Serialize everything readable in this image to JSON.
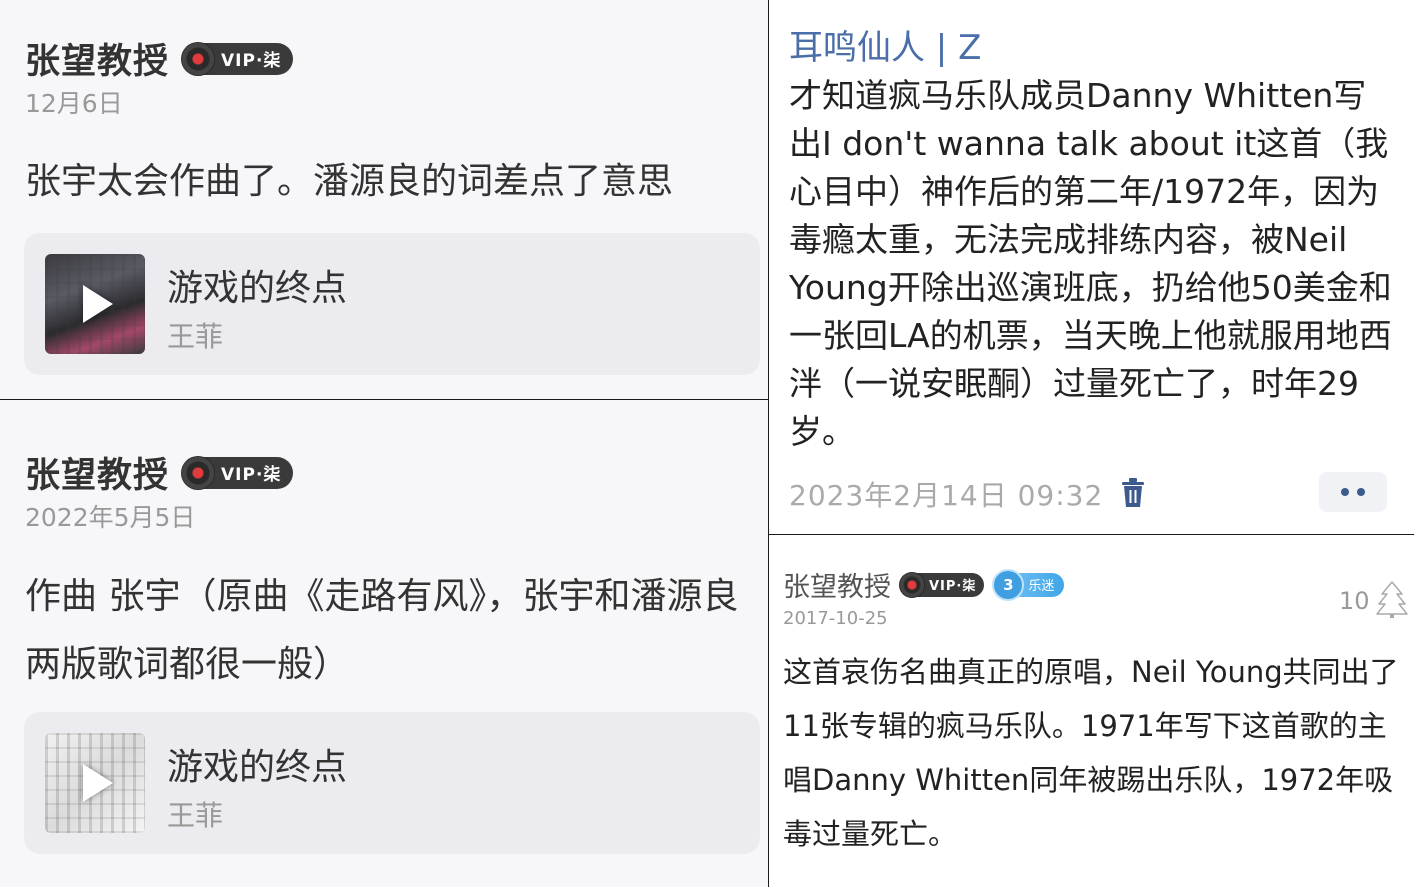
{
  "posts": [
    {
      "author": "张望教授",
      "vip_label": "VIP·柒",
      "date": "12月6日",
      "text": "张宇太会作曲了。潘源良的词差点了意思",
      "song": {
        "title": "游戏的终点",
        "artist": "王菲"
      }
    },
    {
      "author": "张望教授",
      "vip_label": "VIP·柒",
      "date": "2022年5月5日",
      "text": "作曲 张宇（原曲《走路有风》，张宇和潘源良两版歌词都很一般）",
      "song": {
        "title": "游戏的终点",
        "artist": "王菲"
      }
    }
  ],
  "right_top": {
    "author": "耳鸣仙人 | Z",
    "text": "才知道疯马乐队成员Danny Whitten写出I don't wanna talk about it这首（我心目中）神作后的第二年/1972年，因为毒瘾太重，无法完成排练内容，被Neil Young开除出巡演班底，扔给他50美金和一张回LA的机票，当天晚上他就服用地西泮（一说安眠酮）过量死亡了，时年29岁。",
    "timestamp": "2023年2月14日 09:32"
  },
  "right_bottom": {
    "author": "张望教授",
    "vip_label": "VIP·柒",
    "fan_level": "3",
    "fan_label": "乐迷",
    "date": "2017-10-25",
    "likes": "10",
    "text": "这首哀伤名曲真正的原唱，Neil Young共同出了11张专辑的疯马乐队。1971年写下这首歌的主唱Danny Whitten同年被踢出乐队，1972年吸毒过量死亡。"
  },
  "colors": {
    "link_blue": "#4a6ea8",
    "card_bg": "#f7f7fa",
    "song_card_bg": "#ececf0"
  }
}
